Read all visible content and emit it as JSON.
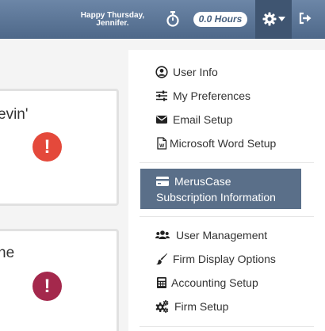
{
  "header": {
    "greeting_line1": "Happy Thursday,",
    "greeting_line2": "Jennifer.",
    "timer_icon": "stopwatch-icon",
    "hours": "0.0 Hours",
    "settings_icon": "gear-icon",
    "logout_icon": "sign-out-icon"
  },
  "cards": [
    {
      "text": "evin'",
      "alert_color": "#e4493b"
    },
    {
      "text": "ne",
      "alert_color": "#a4284c"
    }
  ],
  "menu": {
    "group1": [
      {
        "label": "User Info",
        "icon": "user-circle-icon"
      },
      {
        "label": "My Preferences",
        "icon": "sliders-icon"
      },
      {
        "label": "Email Setup",
        "icon": "envelope-icon"
      },
      {
        "label": "Microsoft Word Setup",
        "icon": "word-document-icon"
      }
    ],
    "subscription": {
      "line1": "MerusCase",
      "line2": "Subscription Information",
      "icon": "credit-card-icon"
    },
    "group2": [
      {
        "label": "User Management",
        "icon": "users-icon"
      },
      {
        "label": "Firm Display Options",
        "icon": "paint-brush-icon"
      },
      {
        "label": "Accounting Setup",
        "icon": "calculator-icon"
      },
      {
        "label": "Firm Setup",
        "icon": "cogs-icon"
      }
    ]
  },
  "colors": {
    "header": "#526c8d",
    "active_item": "#5a6f89",
    "alert_red": "#e4493b",
    "alert_maroon": "#a4284c"
  }
}
